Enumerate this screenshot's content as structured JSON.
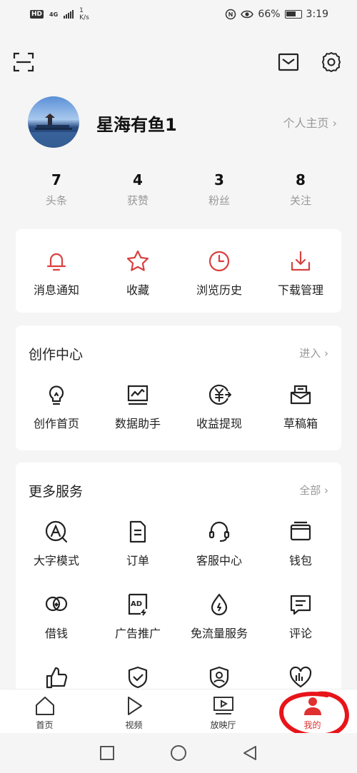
{
  "status_bar": {
    "hd": "HD",
    "network": "4G",
    "speed_value": "1",
    "speed_unit": "K/s",
    "battery": "66%",
    "time": "3:19"
  },
  "profile": {
    "username": "星海有鱼1",
    "homepage_link": "个人主页 ›"
  },
  "stats": [
    {
      "value": "7",
      "label": "头条"
    },
    {
      "value": "4",
      "label": "获赞"
    },
    {
      "value": "3",
      "label": "粉丝"
    },
    {
      "value": "8",
      "label": "关注"
    }
  ],
  "quick_actions": [
    {
      "label": "消息通知",
      "icon": "bell-icon"
    },
    {
      "label": "收藏",
      "icon": "star-icon"
    },
    {
      "label": "浏览历史",
      "icon": "clock-icon"
    },
    {
      "label": "下载管理",
      "icon": "download-icon"
    }
  ],
  "creation_center": {
    "title": "创作中心",
    "more": "进入 ›",
    "items": [
      {
        "label": "创作首页",
        "icon": "lightbulb-icon"
      },
      {
        "label": "数据助手",
        "icon": "chart-icon"
      },
      {
        "label": "收益提现",
        "icon": "yuan-icon"
      },
      {
        "label": "草稿箱",
        "icon": "drafts-icon"
      }
    ]
  },
  "more_services": {
    "title": "更多服务",
    "more": "全部 ›",
    "items": [
      {
        "label": "大字模式",
        "icon": "large-text-icon"
      },
      {
        "label": "订单",
        "icon": "order-icon"
      },
      {
        "label": "客服中心",
        "icon": "headset-icon"
      },
      {
        "label": "钱包",
        "icon": "wallet-icon"
      },
      {
        "label": "借钱",
        "icon": "loan-icon"
      },
      {
        "label": "广告推广",
        "icon": "ad-icon"
      },
      {
        "label": "免流量服务",
        "icon": "data-free-icon"
      },
      {
        "label": "评论",
        "icon": "comment-icon"
      }
    ]
  },
  "tabs": [
    {
      "label": "首页",
      "icon": "home-icon"
    },
    {
      "label": "视频",
      "icon": "video-icon"
    },
    {
      "label": "放映厅",
      "icon": "theater-icon"
    },
    {
      "label": "我的",
      "icon": "user-icon"
    }
  ],
  "colors": {
    "accent": "#e03030",
    "annotation": "#e8141a",
    "text_secondary": "#999999"
  }
}
